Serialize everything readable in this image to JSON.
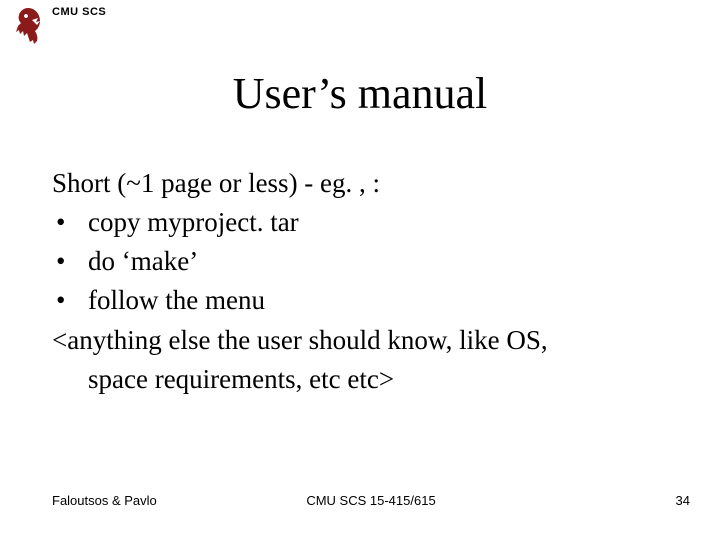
{
  "header": {
    "label": "CMU SCS"
  },
  "title": "User’s manual",
  "content": {
    "intro": "Short (~1 page or less) - eg. , :",
    "bullets": [
      "copy myproject. tar",
      "do ‘make’",
      "follow the menu"
    ],
    "note_line1": "<anything else the user should know, like OS,",
    "note_line2": "space requirements, etc etc>"
  },
  "footer": {
    "left": "Faloutsos & Pavlo",
    "center": "CMU SCS 15-415/615",
    "right": "34"
  }
}
